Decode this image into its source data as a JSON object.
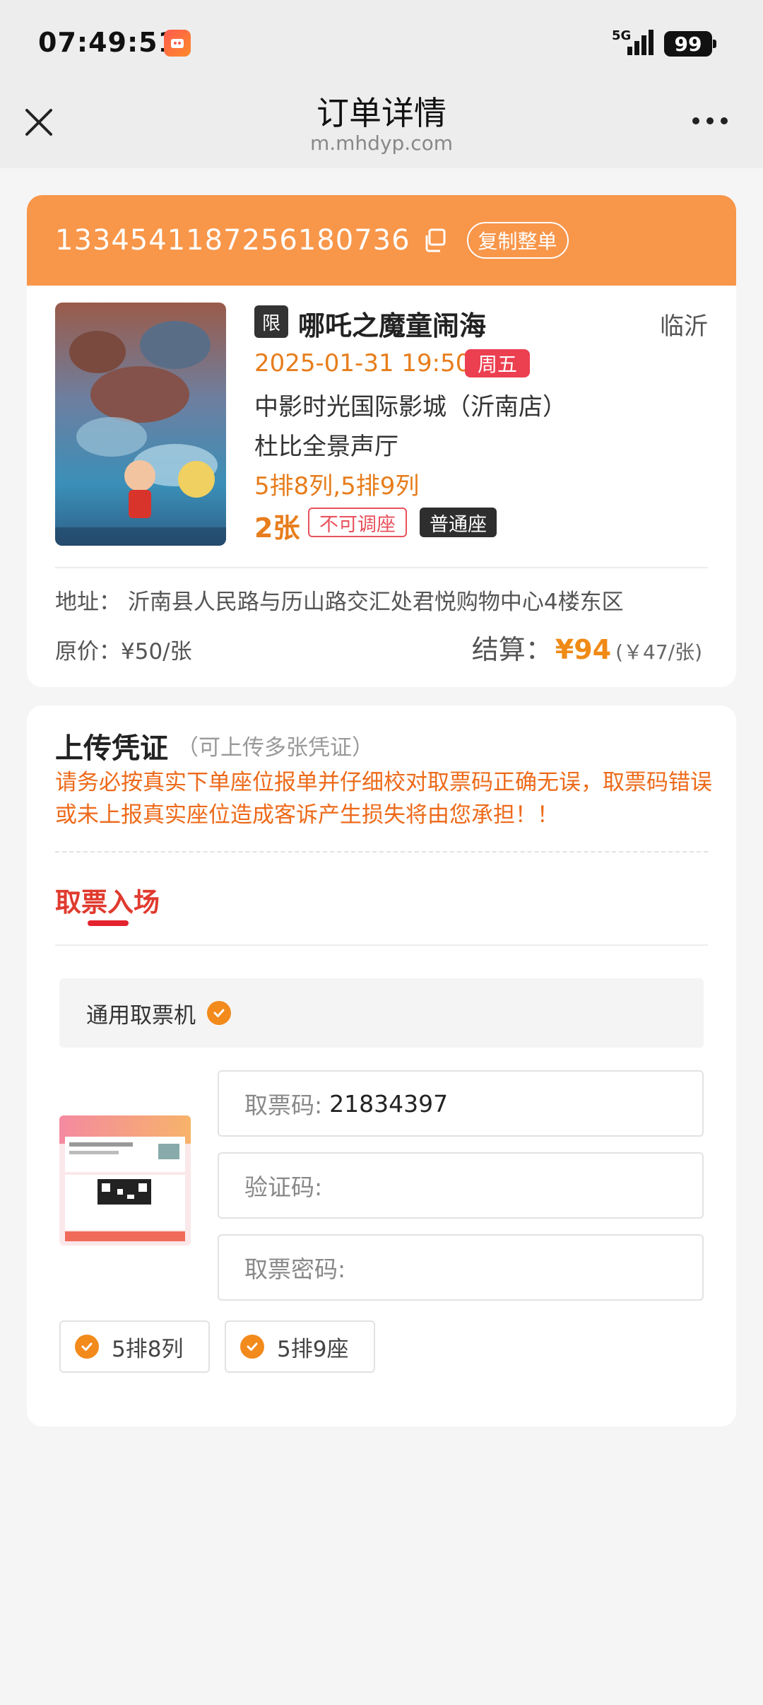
{
  "status_bar": {
    "time": "07:49:51",
    "network": "5G",
    "battery": "99"
  },
  "nav": {
    "title": "订单详情",
    "subtitle": "m.mhdyp.com"
  },
  "order": {
    "number": "1334541187256180736",
    "copy_all_label": "复制整单",
    "tag": "限",
    "movie_title": "哪吒之魔童闹海",
    "city": "临沂",
    "showtime": "2025-01-31 19:50",
    "weekday": "周五",
    "cinema": "中影时光国际影城（沂南店）",
    "hall": "杜比全景声厅",
    "seats": "5排8列,5排9列",
    "ticket_count": "2张",
    "no_adjust_label": "不可调座",
    "seat_type": "普通座",
    "address": "地址：  沂南县人民路与历山路交汇处君悦购物中心4楼东区",
    "original_price": "原价：¥50/张",
    "settle_label": "结算：",
    "settle_amount": "¥94",
    "settle_per": "(￥47/张)"
  },
  "upload": {
    "title": "上传凭证",
    "hint": "（可上传多张凭证）",
    "warning": "请务必按真实下单座位报单并仔细校对取票码正确无误，取票码错误或未上报真实座位造成客诉产生损失将由您承担！！",
    "tab_label": "取票入场",
    "machine_label": "通用取票机",
    "fields": {
      "code_label": "取票码:",
      "code_value": "21834397",
      "verify_label": "验证码:",
      "password_label": "取票密码:"
    },
    "seat_chips": [
      "5排8列",
      "5排9座"
    ]
  },
  "colors": {
    "accent_orange": "#f8964a",
    "price_orange": "#f08a16",
    "warning_orange": "#ed6a1a",
    "tab_red": "#e03a2e"
  }
}
